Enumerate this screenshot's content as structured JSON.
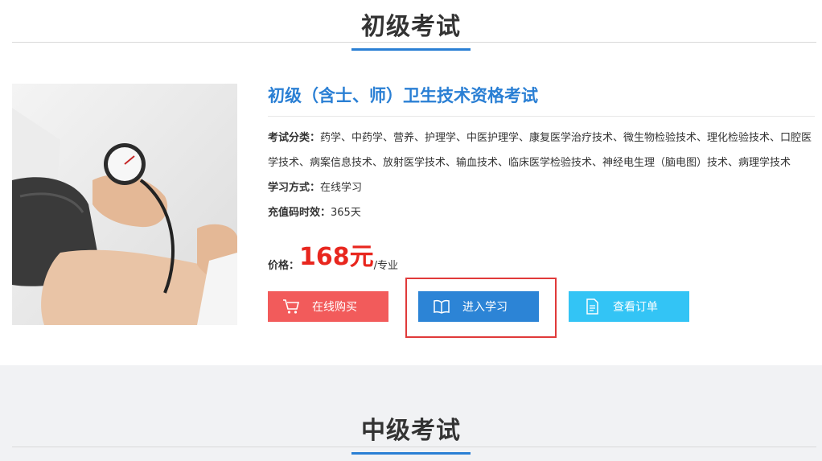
{
  "sections": [
    {
      "title": "初级考试"
    },
    {
      "title": "中级考试"
    }
  ],
  "course": {
    "title": "初级（含士、师）卫生技术资格考试",
    "category_label": "考试分类：",
    "category_value": "药学、中药学、营养、护理学、中医护理学、康复医学治疗技术、微生物检验技术、理化检验技术、口腔医学技术、病案信息技术、放射医学技术、输血技术、临床医学检验技术、神经电生理（脑电图）技术、病理学技术",
    "method_label": "学习方式：",
    "method_value": "在线学习",
    "duration_label": "充值码时效：",
    "duration_value": "365天",
    "price_label": "价格：",
    "price_value": "168元",
    "price_unit": "/专业"
  },
  "buttons": {
    "buy": "在线购买",
    "study": "进入学习",
    "orders": "查看订单"
  },
  "colors": {
    "accent": "#2a7fd4",
    "price": "#e8261e",
    "buy": "#f25b5b",
    "study": "#2c84d6",
    "orders": "#33c4f5",
    "highlight": "#e03a3a"
  },
  "icons": {
    "buy": "cart-icon",
    "study": "book-icon",
    "orders": "document-icon"
  }
}
